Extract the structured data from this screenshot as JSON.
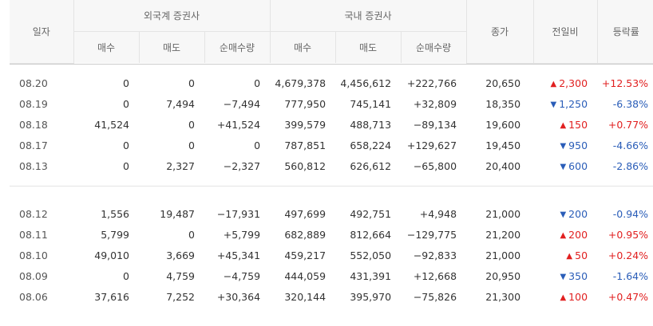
{
  "header": {
    "date": "일자",
    "foreign": "외국계 증권사",
    "domestic": "국내 증권사",
    "close": "종가",
    "change": "전일비",
    "rate": "등락률",
    "buy": "매수",
    "sell": "매도",
    "net": "순매수량"
  },
  "groups": [
    {
      "rows": [
        {
          "date": "08.20",
          "f_buy": "0",
          "f_sell": "0",
          "f_net": "0",
          "f_net_dir": "same",
          "d_buy": "4,679,378",
          "d_sell": "4,456,612",
          "d_net": "+222,766",
          "d_net_dir": "up",
          "close": "20,650",
          "diff": "2,300",
          "diff_dir": "up",
          "rate": "+12.53%",
          "rate_dir": "up"
        },
        {
          "date": "08.19",
          "f_buy": "0",
          "f_sell": "7,494",
          "f_net": "−7,494",
          "f_net_dir": "down",
          "d_buy": "777,950",
          "d_sell": "745,141",
          "d_net": "+32,809",
          "d_net_dir": "up",
          "close": "18,350",
          "diff": "1,250",
          "diff_dir": "down",
          "rate": "-6.38%",
          "rate_dir": "down"
        },
        {
          "date": "08.18",
          "f_buy": "41,524",
          "f_sell": "0",
          "f_net": "+41,524",
          "f_net_dir": "up",
          "d_buy": "399,579",
          "d_sell": "488,713",
          "d_net": "−89,134",
          "d_net_dir": "down",
          "close": "19,600",
          "diff": "150",
          "diff_dir": "up",
          "rate": "+0.77%",
          "rate_dir": "up"
        },
        {
          "date": "08.17",
          "f_buy": "0",
          "f_sell": "0",
          "f_net": "0",
          "f_net_dir": "same",
          "d_buy": "787,851",
          "d_sell": "658,224",
          "d_net": "+129,627",
          "d_net_dir": "up",
          "close": "19,450",
          "diff": "950",
          "diff_dir": "down",
          "rate": "-4.66%",
          "rate_dir": "down"
        },
        {
          "date": "08.13",
          "f_buy": "0",
          "f_sell": "2,327",
          "f_net": "−2,327",
          "f_net_dir": "down",
          "d_buy": "560,812",
          "d_sell": "626,612",
          "d_net": "−65,800",
          "d_net_dir": "down",
          "close": "20,400",
          "diff": "600",
          "diff_dir": "down",
          "rate": "-2.86%",
          "rate_dir": "down"
        }
      ]
    },
    {
      "rows": [
        {
          "date": "08.12",
          "f_buy": "1,556",
          "f_sell": "19,487",
          "f_net": "−17,931",
          "f_net_dir": "down",
          "d_buy": "497,699",
          "d_sell": "492,751",
          "d_net": "+4,948",
          "d_net_dir": "up",
          "close": "21,000",
          "diff": "200",
          "diff_dir": "down",
          "rate": "-0.94%",
          "rate_dir": "down"
        },
        {
          "date": "08.11",
          "f_buy": "5,799",
          "f_sell": "0",
          "f_net": "+5,799",
          "f_net_dir": "up",
          "d_buy": "682,889",
          "d_sell": "812,664",
          "d_net": "−129,775",
          "d_net_dir": "down",
          "close": "21,200",
          "diff": "200",
          "diff_dir": "up",
          "rate": "+0.95%",
          "rate_dir": "up"
        },
        {
          "date": "08.10",
          "f_buy": "49,010",
          "f_sell": "3,669",
          "f_net": "+45,341",
          "f_net_dir": "up",
          "d_buy": "459,217",
          "d_sell": "552,050",
          "d_net": "−92,833",
          "d_net_dir": "down",
          "close": "21,000",
          "diff": "50",
          "diff_dir": "up",
          "rate": "+0.24%",
          "rate_dir": "up"
        },
        {
          "date": "08.09",
          "f_buy": "0",
          "f_sell": "4,759",
          "f_net": "−4,759",
          "f_net_dir": "down",
          "d_buy": "444,059",
          "d_sell": "431,391",
          "d_net": "+12,668",
          "d_net_dir": "up",
          "close": "20,950",
          "diff": "350",
          "diff_dir": "down",
          "rate": "-1.64%",
          "rate_dir": "down"
        },
        {
          "date": "08.06",
          "f_buy": "37,616",
          "f_sell": "7,252",
          "f_net": "+30,364",
          "f_net_dir": "up",
          "d_buy": "320,144",
          "d_sell": "395,970",
          "d_net": "−75,826",
          "d_net_dir": "down",
          "close": "21,300",
          "diff": "100",
          "diff_dir": "up",
          "rate": "+0.47%",
          "rate_dir": "up"
        }
      ]
    }
  ],
  "colors": {
    "up": "#e12020",
    "down": "#2a5db8",
    "header_bg": "#f7f7f7"
  },
  "icons": {
    "up": "triangle-up-icon",
    "down": "triangle-down-icon"
  }
}
